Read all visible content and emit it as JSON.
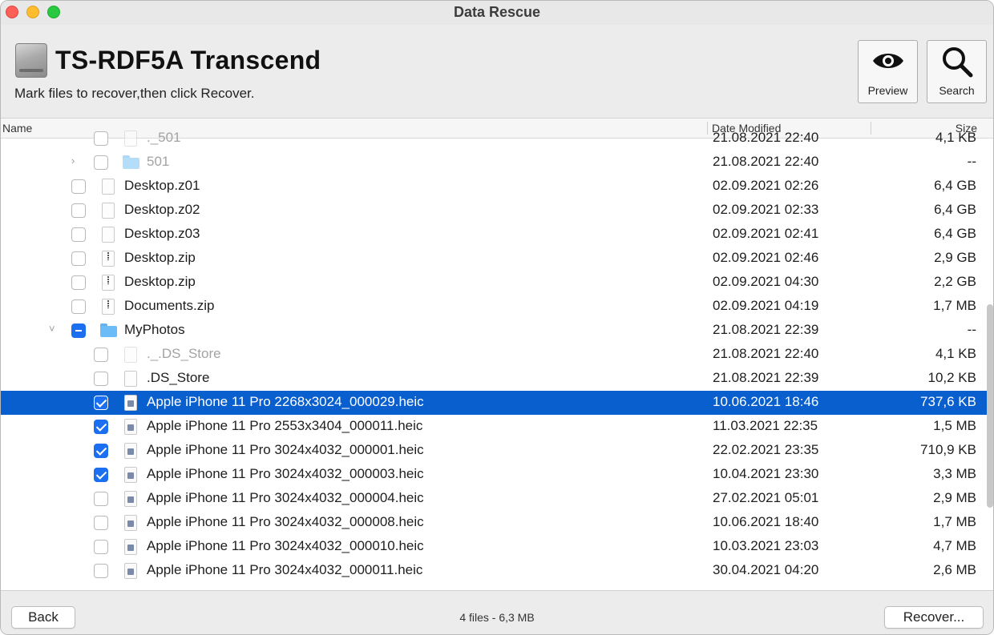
{
  "window": {
    "title": "Data Rescue"
  },
  "header": {
    "device_name": "TS-RDF5A Transcend",
    "instructions": "Mark files to recover,then click Recover.",
    "preview_label": "Preview",
    "search_label": "Search"
  },
  "columns": {
    "name": "Name",
    "date": "Date Modified",
    "size": "Size"
  },
  "rows": [
    {
      "name": "._501",
      "date": "21.08.2021 22:40",
      "size": "4,1 KB",
      "indent": 2,
      "kind": "file",
      "dim": true,
      "checked": "none",
      "chevron": ""
    },
    {
      "name": "501",
      "date": "21.08.2021 22:40",
      "size": "--",
      "indent": 2,
      "kind": "folder",
      "dim": true,
      "checked": "none",
      "chevron": "right"
    },
    {
      "name": "Desktop.z01",
      "date": "02.09.2021 02:26",
      "size": "6,4 GB",
      "indent": 1,
      "kind": "file",
      "dim": false,
      "checked": "none",
      "chevron": ""
    },
    {
      "name": "Desktop.z02",
      "date": "02.09.2021 02:33",
      "size": "6,4 GB",
      "indent": 1,
      "kind": "file",
      "dim": false,
      "checked": "none",
      "chevron": ""
    },
    {
      "name": "Desktop.z03",
      "date": "02.09.2021 02:41",
      "size": "6,4 GB",
      "indent": 1,
      "kind": "file",
      "dim": false,
      "checked": "none",
      "chevron": ""
    },
    {
      "name": "Desktop.zip",
      "date": "02.09.2021 02:46",
      "size": "2,9 GB",
      "indent": 1,
      "kind": "zip",
      "dim": false,
      "checked": "none",
      "chevron": ""
    },
    {
      "name": "Desktop.zip",
      "date": "02.09.2021 04:30",
      "size": "2,2 GB",
      "indent": 1,
      "kind": "zip",
      "dim": false,
      "checked": "none",
      "chevron": ""
    },
    {
      "name": "Documents.zip",
      "date": "02.09.2021 04:19",
      "size": "1,7 MB",
      "indent": 1,
      "kind": "zip",
      "dim": false,
      "checked": "none",
      "chevron": ""
    },
    {
      "name": "MyPhotos",
      "date": "21.08.2021 22:39",
      "size": "--",
      "indent": 1,
      "kind": "folder",
      "dim": false,
      "checked": "mixed",
      "chevron": "down"
    },
    {
      "name": "._.DS_Store",
      "date": "21.08.2021 22:40",
      "size": "4,1 KB",
      "indent": 2,
      "kind": "file",
      "dim": true,
      "checked": "none",
      "chevron": ""
    },
    {
      "name": ".DS_Store",
      "date": "21.08.2021 22:39",
      "size": "10,2 KB",
      "indent": 2,
      "kind": "file",
      "dim": false,
      "checked": "none",
      "chevron": ""
    },
    {
      "name": "Apple iPhone 11 Pro 2268x3024_000029.heic",
      "date": "10.06.2021 18:46",
      "size": "737,6 KB",
      "indent": 2,
      "kind": "heic",
      "dim": false,
      "checked": "checked",
      "chevron": "",
      "selected": true
    },
    {
      "name": "Apple iPhone 11 Pro 2553x3404_000011.heic",
      "date": "11.03.2021 22:35",
      "size": "1,5 MB",
      "indent": 2,
      "kind": "heic",
      "dim": false,
      "checked": "checked",
      "chevron": ""
    },
    {
      "name": "Apple iPhone 11 Pro 3024x4032_000001.heic",
      "date": "22.02.2021 23:35",
      "size": "710,9 KB",
      "indent": 2,
      "kind": "heic",
      "dim": false,
      "checked": "checked",
      "chevron": ""
    },
    {
      "name": "Apple iPhone 11 Pro 3024x4032_000003.heic",
      "date": "10.04.2021 23:30",
      "size": "3,3 MB",
      "indent": 2,
      "kind": "heic",
      "dim": false,
      "checked": "checked",
      "chevron": ""
    },
    {
      "name": "Apple iPhone 11 Pro 3024x4032_000004.heic",
      "date": "27.02.2021 05:01",
      "size": "2,9 MB",
      "indent": 2,
      "kind": "heic",
      "dim": false,
      "checked": "none",
      "chevron": ""
    },
    {
      "name": "Apple iPhone 11 Pro 3024x4032_000008.heic",
      "date": "10.06.2021 18:40",
      "size": "1,7 MB",
      "indent": 2,
      "kind": "heic",
      "dim": false,
      "checked": "none",
      "chevron": ""
    },
    {
      "name": "Apple iPhone 11 Pro 3024x4032_000010.heic",
      "date": "10.03.2021 23:03",
      "size": "4,7 MB",
      "indent": 2,
      "kind": "heic",
      "dim": false,
      "checked": "none",
      "chevron": ""
    },
    {
      "name": "Apple iPhone 11 Pro 3024x4032_000011.heic",
      "date": "30.04.2021 04:20",
      "size": "2,6 MB",
      "indent": 2,
      "kind": "heic",
      "dim": false,
      "checked": "none",
      "chevron": ""
    }
  ],
  "footer": {
    "back_label": "Back",
    "status": "4 files - 6,3 MB",
    "recover_label": "Recover..."
  },
  "icons": {
    "preview": "eye-icon",
    "search": "magnifier-icon",
    "drive": "hard-drive-icon"
  },
  "colors": {
    "selection": "#0a5fcf",
    "checkbox_checked": "#1b6ff0",
    "folder": "#6cbcf7"
  }
}
